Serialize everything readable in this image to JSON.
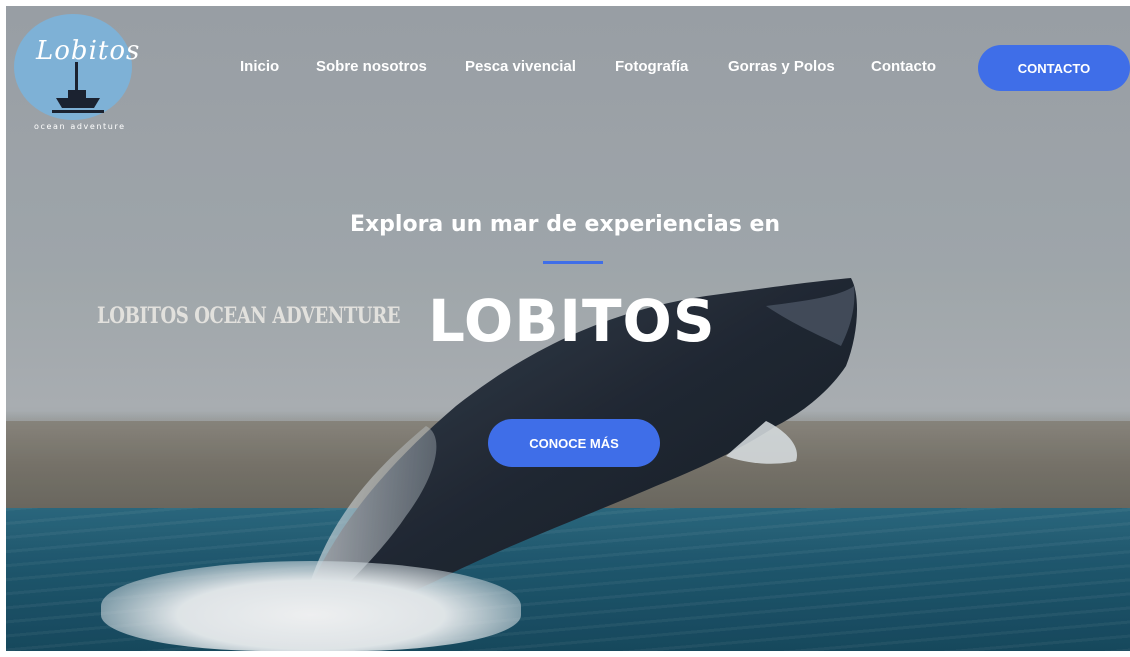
{
  "logo": {
    "script_text": "Lobitos",
    "tagline": "ocean adventure"
  },
  "nav": {
    "items": [
      {
        "label": "Inicio"
      },
      {
        "label": "Sobre nosotros"
      },
      {
        "label": "Pesca vivencial"
      },
      {
        "label": "Fotografía"
      },
      {
        "label": "Gorras y Polos"
      },
      {
        "label": "Contacto"
      }
    ],
    "cta_label": "CONTACTO"
  },
  "hero": {
    "subtitle": "Explora un mar de experiencias en",
    "overlay_text": "LOBITOS OCEAN ADVENTURE",
    "title": "LOBITOS",
    "cta_label": "CONOCE MÁS"
  },
  "colors": {
    "accent": "#3f6ee8",
    "logo_circle": "#7eb1d6",
    "text": "#ffffff"
  }
}
